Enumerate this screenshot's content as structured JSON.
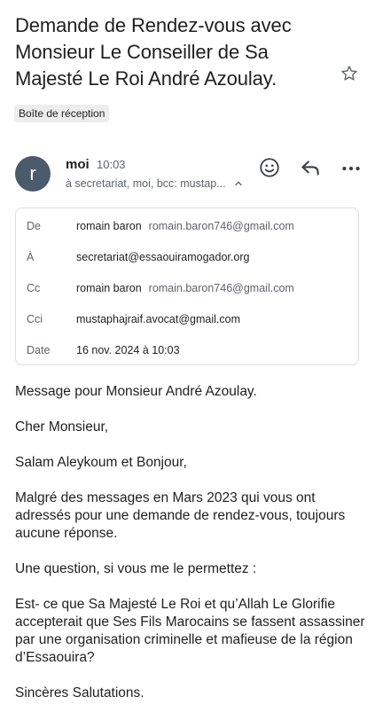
{
  "subject": "Demande de Rendez-vous avec Monsieur Le Conseiller de Sa Majesté Le Roi André Azoulay.",
  "label": "Boîte de réception",
  "icons": {
    "star": "star-icon",
    "emoji": "emoji-icon",
    "reply": "reply-icon",
    "more": "more-icon",
    "chevron": "chevron-up-icon"
  },
  "sender": {
    "avatar_letter": "r",
    "avatar_color": "#4b5b6b",
    "name": "moi",
    "time": "10:03",
    "recipients_summary": "à secretariat, moi, bcc: mustap..."
  },
  "details": {
    "from_label": "De",
    "from_name": "romain baron",
    "from_email": "romain.baron746@gmail.com",
    "to_label": "À",
    "to_email": "secretariat@essaouiramogador.org",
    "cc_label": "Cc",
    "cc_name": "romain baron",
    "cc_email": "romain.baron746@gmail.com",
    "bcc_label": "Cci",
    "bcc_email": "mustaphajraif.avocat@gmail.com",
    "date_label": "Date",
    "date_value": "16 nov. 2024 à 10:03"
  },
  "body": {
    "p1": "Message pour Monsieur André Azoulay.",
    "p2": "Cher Monsieur,",
    "p3": "Salam Aleykoum et Bonjour,",
    "p4": "Malgré des messages en Mars 2023 qui vous ont adressés pour une demande de rendez-vous, toujours aucune réponse.",
    "p5": "Une question, si vous me le permettez :",
    "p6": "Est- ce que Sa Majesté Le Roi et qu’Allah Le Glorifie accepterait que Ses Fils Marocains se fassent assassiner par une organisation criminelle et mafieuse de la région d’Essaouira?",
    "p7": "Sincères Salutations."
  }
}
